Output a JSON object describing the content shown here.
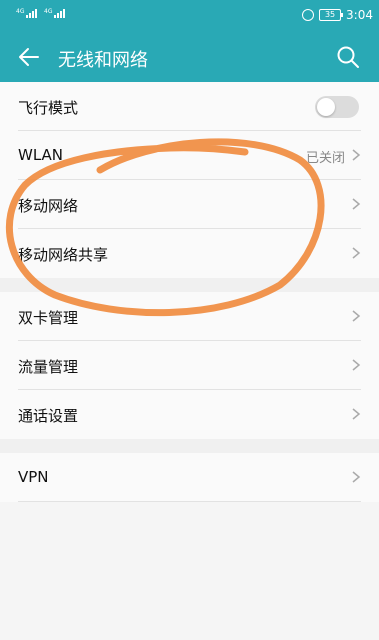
{
  "status_bar": {
    "signal1_tag": "4G",
    "signal2_tag": "4G",
    "battery": "35",
    "time": "3:04"
  },
  "header": {
    "title": "无线和网络"
  },
  "settings": {
    "airplane_mode": {
      "label": "飞行模式",
      "state": "off"
    },
    "wlan": {
      "label": "WLAN",
      "value": "已关闭"
    },
    "mobile_network": {
      "label": "移动网络"
    },
    "tethering": {
      "label": "移动网络共享"
    },
    "dual_sim": {
      "label": "双卡管理"
    },
    "data_usage": {
      "label": "流量管理"
    },
    "call_settings": {
      "label": "通话设置"
    },
    "vpn": {
      "label": "VPN"
    }
  },
  "colors": {
    "header": "#29a9b5",
    "annotation": "#f08a3c"
  }
}
